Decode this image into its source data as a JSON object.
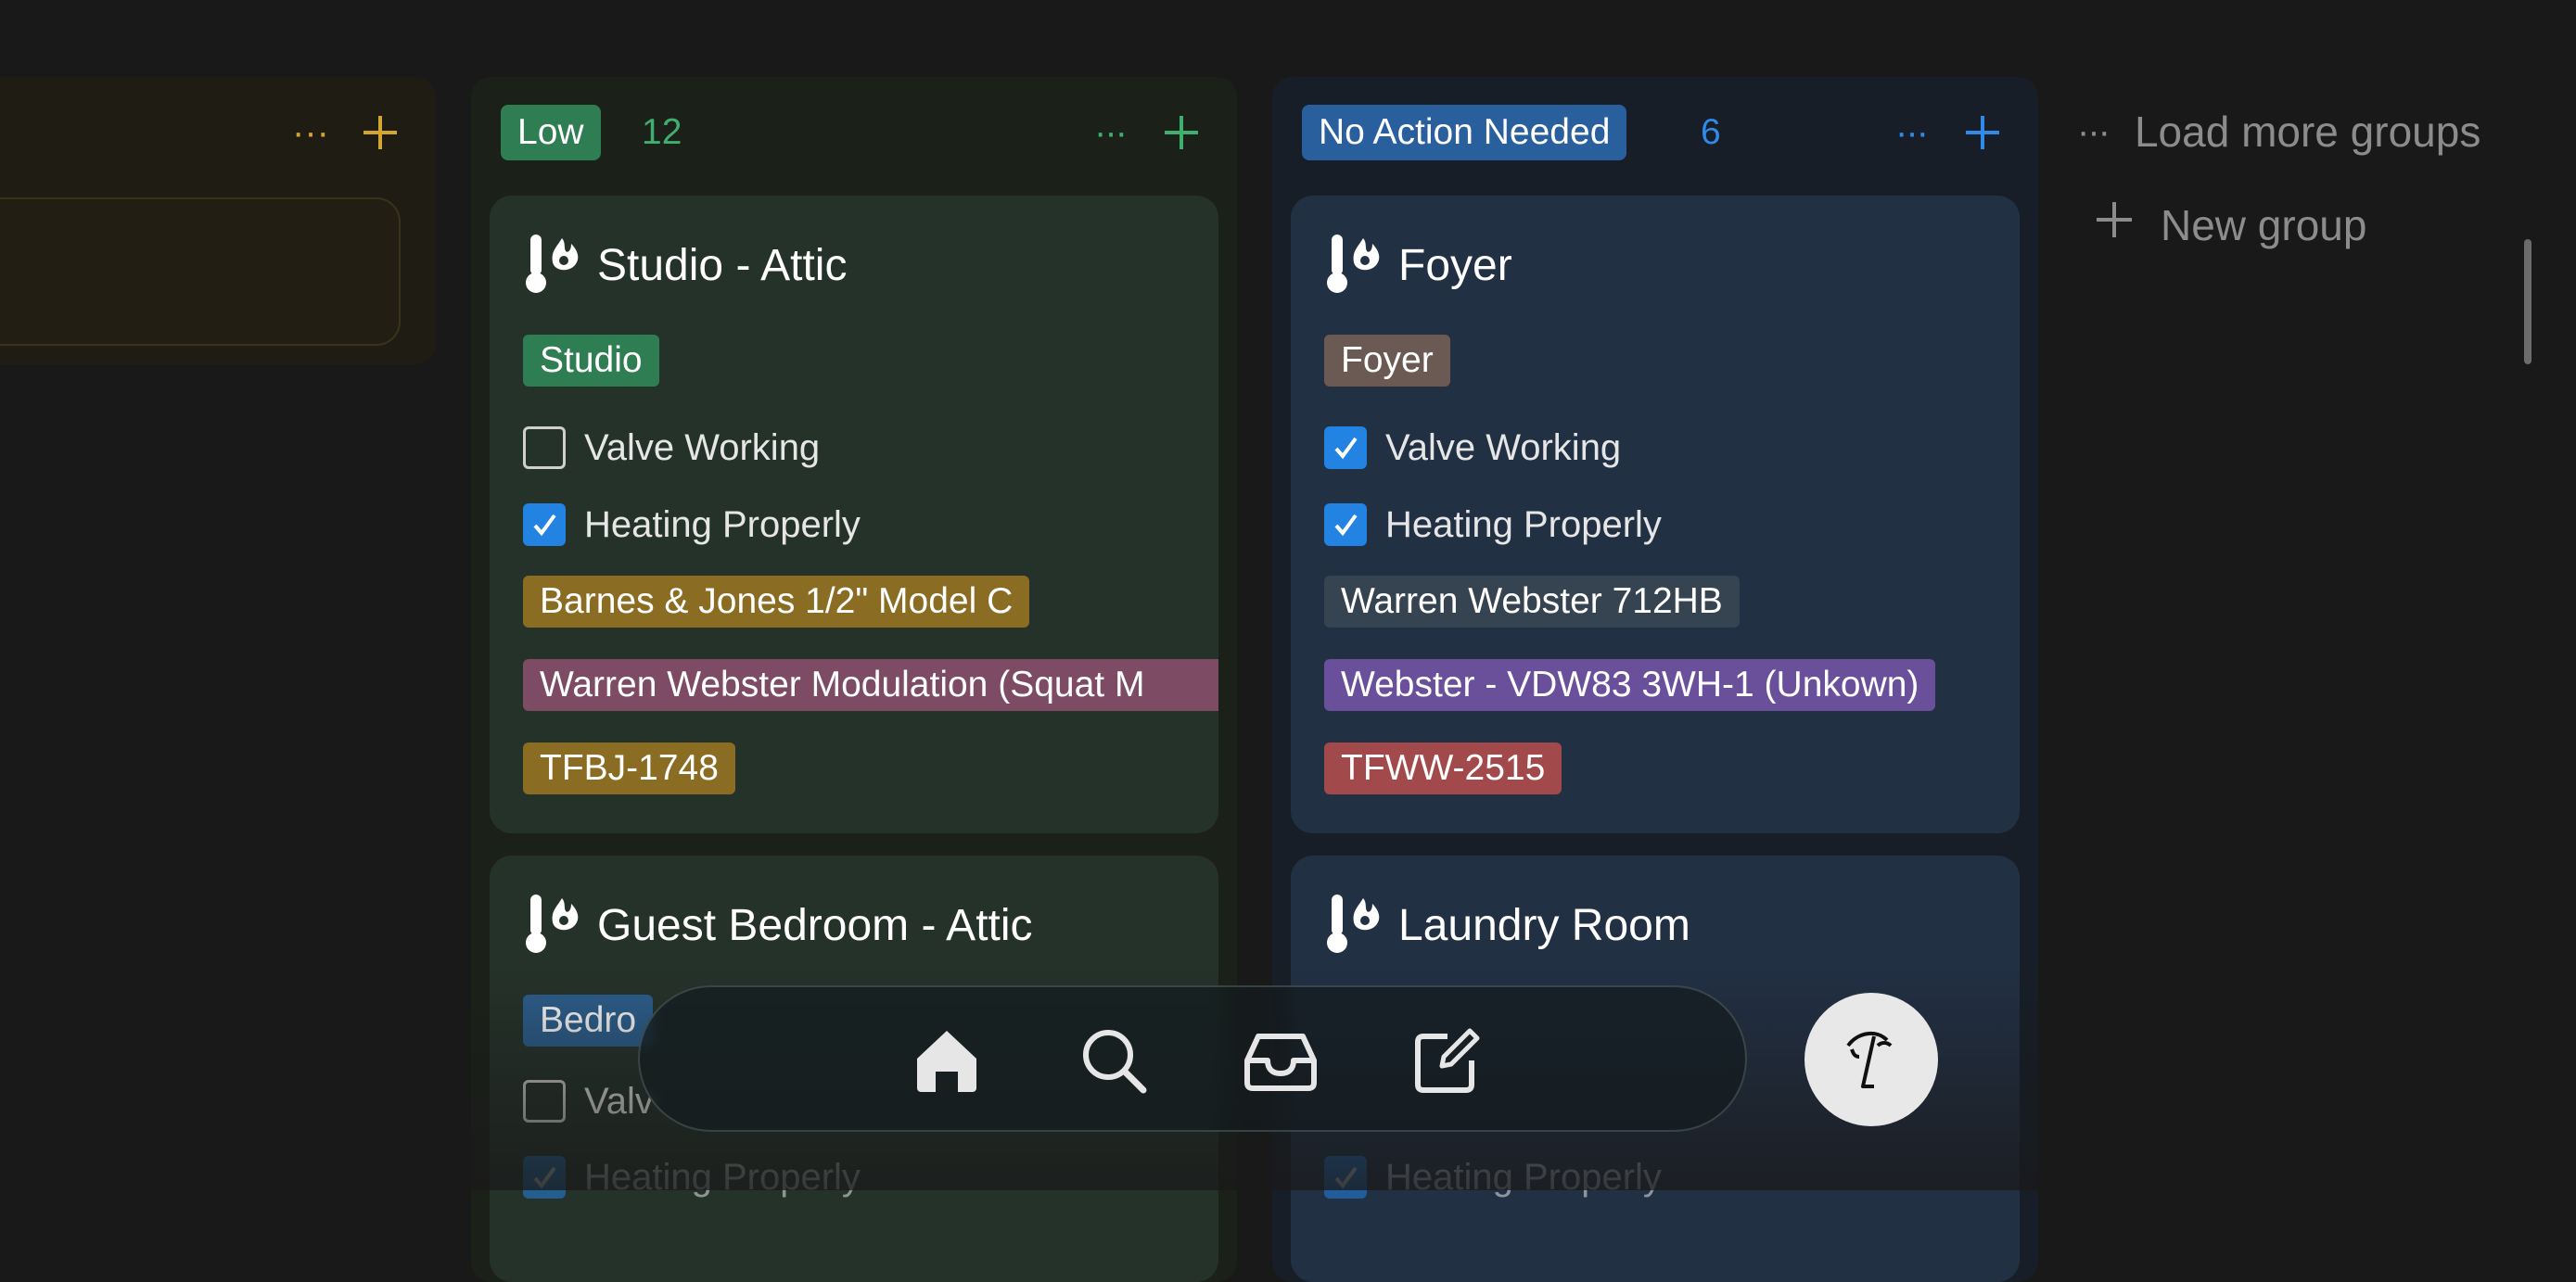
{
  "prev_group": {
    "dots": "···",
    "plus": "+"
  },
  "groups": [
    {
      "title": "Low",
      "count": "12",
      "title_color": "#2f7d52",
      "accent": "#3fae6f",
      "cards": [
        {
          "icon": "thermometer-flame-icon",
          "name": "Studio - Attic",
          "room_tag": "Studio",
          "valve_label": "Valve Working",
          "valve_checked": false,
          "heating_label": "Heating Properly",
          "heating_checked": true,
          "valve_model": "Barnes & Jones 1/2\" Model C",
          "radiator_model": "Warren Webster Modulation (Squat M",
          "code": "TFBJ-1748"
        },
        {
          "icon": "thermometer-flame-icon",
          "name": "Guest Bedroom - Attic",
          "room_tag": "Bedro",
          "valve_label": "Valv",
          "heating_label": "Heating Properly"
        }
      ]
    },
    {
      "title": "No Action Needed",
      "count": "6",
      "title_color": "#2a5f9e",
      "accent": "#2f8ae8",
      "cards": [
        {
          "icon": "thermometer-flame-icon",
          "name": "Foyer",
          "room_tag": "Foyer",
          "valve_label": "Valve Working",
          "valve_checked": true,
          "heating_label": "Heating Properly",
          "heating_checked": true,
          "valve_model": "Warren Webster 712HB",
          "radiator_model": "Webster - VDW83 3WH-1 (Unkown)",
          "code": "TFWW-2515"
        },
        {
          "icon": "thermometer-flame-icon",
          "name": "Laundry Room",
          "heating_label": "Heating Properly"
        }
      ]
    }
  ],
  "sidebar": {
    "load_more": "Load more groups",
    "new_group": "New group"
  },
  "dock": {
    "items": [
      "home-icon",
      "search-icon",
      "inbox-icon",
      "compose-icon"
    ]
  },
  "avatar": "profile-avatar"
}
